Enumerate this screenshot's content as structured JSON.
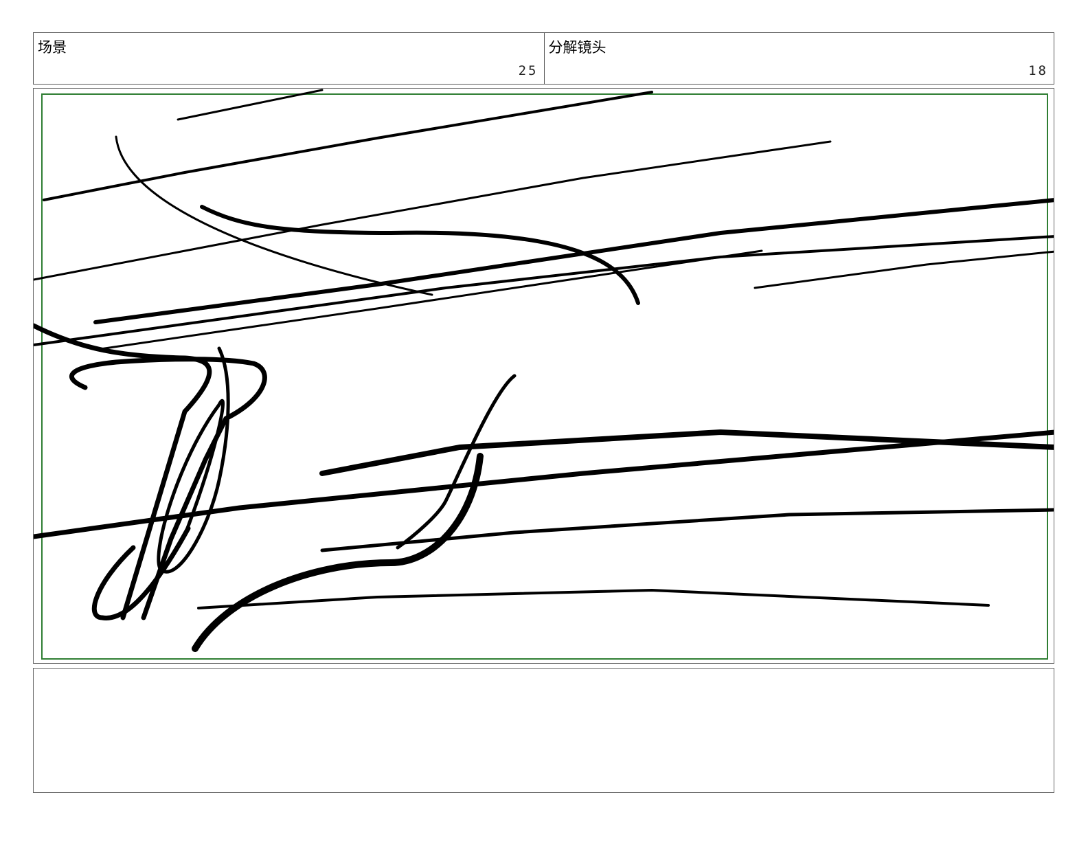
{
  "header": {
    "scene_label": "场景",
    "scene_number": "25",
    "shot_label": "分解镜头",
    "shot_number": "18"
  },
  "panel": {
    "safe_frame_color": "#2e7d32",
    "sketch_stroke_color": "#000000"
  },
  "notes": {
    "text": ""
  }
}
